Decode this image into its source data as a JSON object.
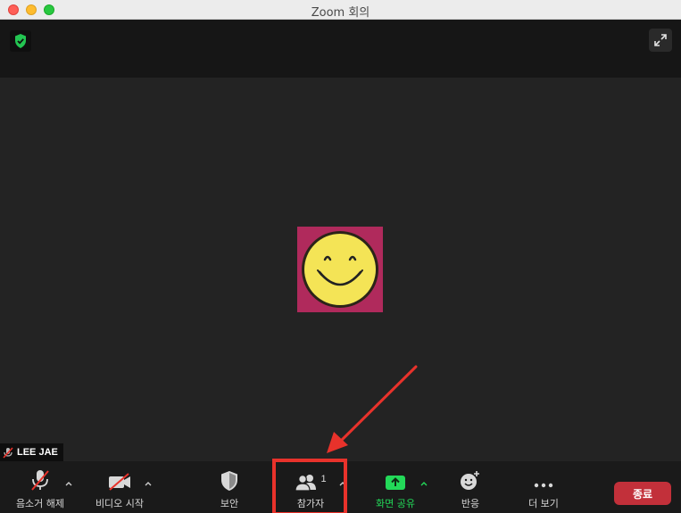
{
  "window": {
    "title": "Zoom 회의"
  },
  "participant": {
    "name": "LEE JAE",
    "avatar_color": "#b02a5c"
  },
  "toolbar": {
    "unmute_label": "음소거 해제",
    "start_video_label": "비디오 시작",
    "security_label": "보안",
    "participants_label": "참가자",
    "participants_count": "1",
    "share_screen_label": "화면 공유",
    "reactions_label": "반응",
    "more_label": "더 보기",
    "end_label": "종료"
  },
  "colors": {
    "share_green": "#23d959",
    "end_red": "#c2303a",
    "annotation_red": "#e8322b"
  },
  "icons": {
    "secure": "shield-check-icon",
    "fullscreen": "expand-icon",
    "mic": "mic-muted-icon",
    "video": "video-off-icon",
    "security": "shield-icon",
    "participants": "people-icon",
    "share": "share-up-arrow-icon",
    "reactions": "smiley-plus-icon",
    "more": "ellipsis-icon"
  }
}
